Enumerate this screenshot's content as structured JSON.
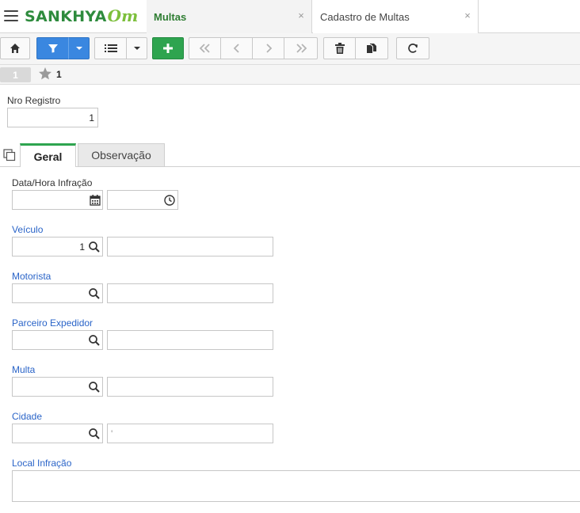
{
  "header": {
    "logo_main": "SANKHYA",
    "logo_suffix": "Om",
    "tabs": [
      {
        "label": "Multas",
        "close": "×"
      },
      {
        "label": "Cadastro de Multas",
        "close": "×"
      }
    ]
  },
  "toolbar": {
    "buttons": [
      "home-icon",
      "filter-icon",
      "caret-down-icon",
      "list-icon",
      "caret-down-icon",
      "plus-icon",
      "first-icon",
      "prev-icon",
      "next-icon",
      "last-icon",
      "trash-icon",
      "copy-icon",
      "refresh-icon"
    ]
  },
  "record_bar": {
    "index": "1",
    "current": "1"
  },
  "form": {
    "nro_registro": {
      "label": "Nro Registro",
      "value": "1"
    },
    "tabs": [
      {
        "label": "Geral"
      },
      {
        "label": "Observação"
      }
    ],
    "data_hora": {
      "label": "Data/Hora Infração",
      "date": "",
      "time": ""
    },
    "veiculo": {
      "label": "Veículo",
      "code": "1",
      "desc": ""
    },
    "motorista": {
      "label": "Motorista",
      "code": "",
      "desc": ""
    },
    "parceiro": {
      "label": "Parceiro Expedidor",
      "code": "",
      "desc": ""
    },
    "multa": {
      "label": "Multa",
      "code": "",
      "desc": ""
    },
    "cidade": {
      "label": "Cidade",
      "code": "",
      "desc": "'"
    },
    "local": {
      "label": "Local Infração",
      "value": ""
    }
  },
  "colors": {
    "brand_green": "#2e8b3d",
    "accent_blue": "#3a87e0",
    "add_green": "#2ea44f",
    "link_blue": "#2a64c8"
  }
}
